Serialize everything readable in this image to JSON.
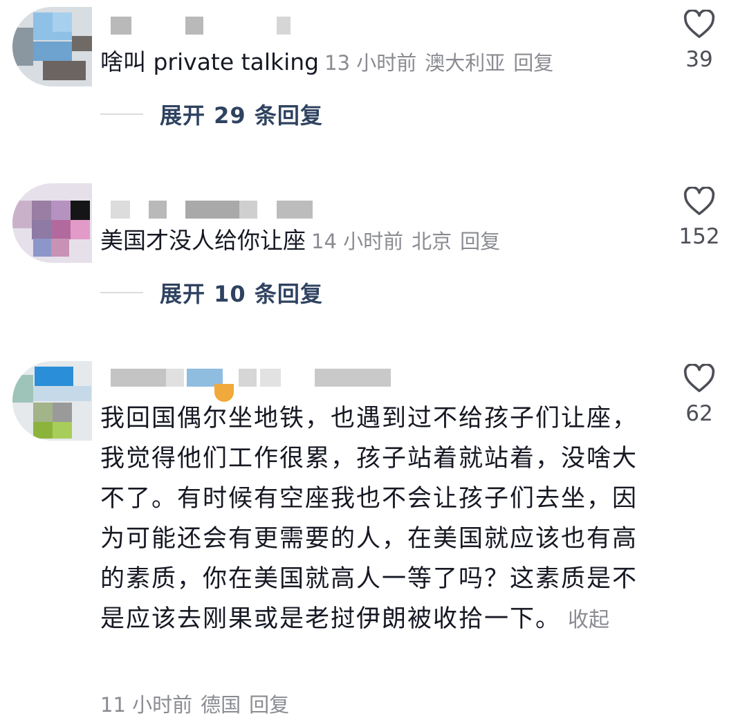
{
  "comments": [
    {
      "text": "啥叫 private talking",
      "time": "13 小时前",
      "location": "澳大利亚",
      "reply": "回复",
      "expand": "展开 29 条回复",
      "likes": "39"
    },
    {
      "text": "美国才没人给你让座",
      "time": "14 小时前",
      "location": "北京",
      "reply": "回复",
      "expand": "展开 10 条回复",
      "likes": "152"
    },
    {
      "text": "我回国偶尔坐地铁，也遇到过不给孩子们让座，我觉得他们工作很累，孩子站着就站着，没啥大不了。有时候有空座我也不会让孩子们去坐，因为可能还会有更需要的人，在美国就应该也有高的素质，你在美国就高人一等了吗？这素质是不是应该去刚果或是老挝伊朗被收拾一下。",
      "collapse": "收起",
      "time": "11 小时前",
      "location": "德国",
      "reply": "回复",
      "likes": "62"
    }
  ],
  "icons": {
    "like": "heart-outline-icon"
  },
  "colors": {
    "text": "#161823",
    "meta": "#8a8b91",
    "expand": "#2f4260",
    "likeCount": "#4d4f57"
  }
}
